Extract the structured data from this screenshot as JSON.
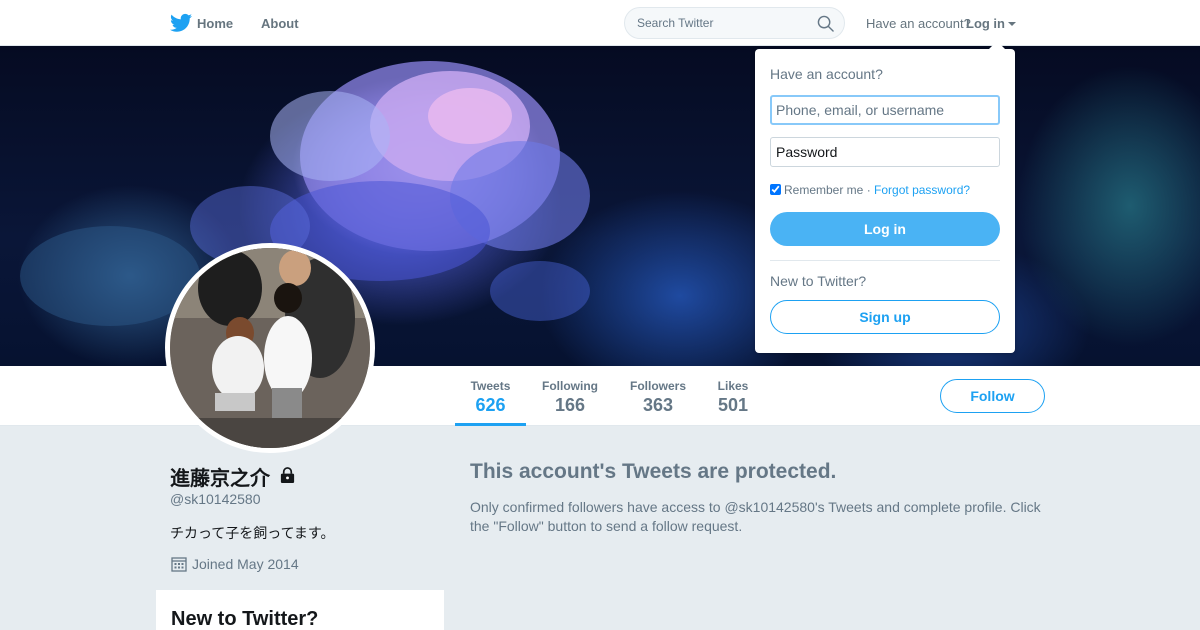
{
  "nav": {
    "home_label": "Home",
    "about_label": "About",
    "search_placeholder": "Search Twitter",
    "have_account": "Have an account?",
    "login_label": "Log in",
    "brand_color": "#1da1f2",
    "icons": [
      "twitter-bird-icon",
      "search-icon",
      "caret-down-icon"
    ]
  },
  "profile": {
    "name": "進藤京之介",
    "handle": "@sk10142580",
    "bio": "チカって子を飼ってます。",
    "joined": "Joined May 2014",
    "icons": [
      "lock-icon",
      "calendar-icon"
    ]
  },
  "stats": [
    {
      "label": "Tweets",
      "value": "626",
      "active": true
    },
    {
      "label": "Following",
      "value": "166",
      "active": false
    },
    {
      "label": "Followers",
      "value": "363",
      "active": false
    },
    {
      "label": "Likes",
      "value": "501",
      "active": false
    }
  ],
  "follow_label": "Follow",
  "protected": {
    "title": "This account's Tweets are protected.",
    "body": "Only confirmed followers have access to @sk10142580's Tweets and complete profile. Click the \"Follow\" button to send a follow request."
  },
  "sidebar_card": {
    "title": "New to Twitter?"
  },
  "login_dropdown": {
    "title": "Have an account?",
    "username_placeholder": "Phone, email, or username",
    "password_placeholder": "Password",
    "remember_label": "Remember me",
    "separator": "·",
    "forgot_label": "Forgot password?",
    "remember_checked": true,
    "login_button": "Log in",
    "new_label": "New to Twitter?",
    "signup_button": "Sign up"
  }
}
